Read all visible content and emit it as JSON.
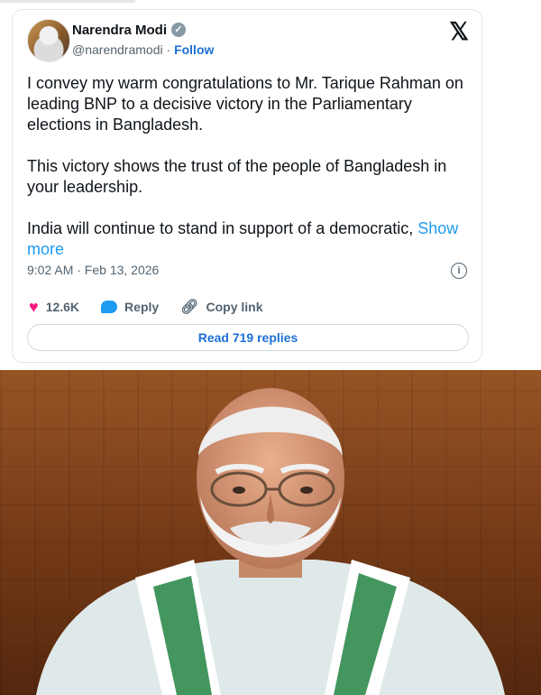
{
  "author": {
    "name": "Narendra Modi",
    "handle": "@narendramodi",
    "separator": "·",
    "follow_label": "Follow"
  },
  "brand": {
    "logo": "𝕏"
  },
  "tweet": {
    "text": "I convey my warm congratulations to Mr. Tarique Rahman on leading BNP to a decisive victory in the Parliamentary elections in Bangladesh.\n\nThis victory shows the trust of the people of Bangladesh in your leadership.\n\nIndia will continue to stand in support of a democratic, ",
    "show_more": "Show more"
  },
  "meta": {
    "time": "9:02 AM · Feb 13, 2026"
  },
  "actions": {
    "likes": "12.6K",
    "reply": "Reply",
    "copy_link": "Copy link"
  },
  "read_replies": "Read 719 replies",
  "icons": {
    "verified": "verified-badge-icon",
    "info": "info-icon",
    "heart": "heart-icon",
    "reply": "reply-bubble-icon",
    "link": "link-icon"
  },
  "colors": {
    "accent": "#1d9bf0",
    "like": "#f91880",
    "text": "#0f1419",
    "muted": "#536471"
  }
}
